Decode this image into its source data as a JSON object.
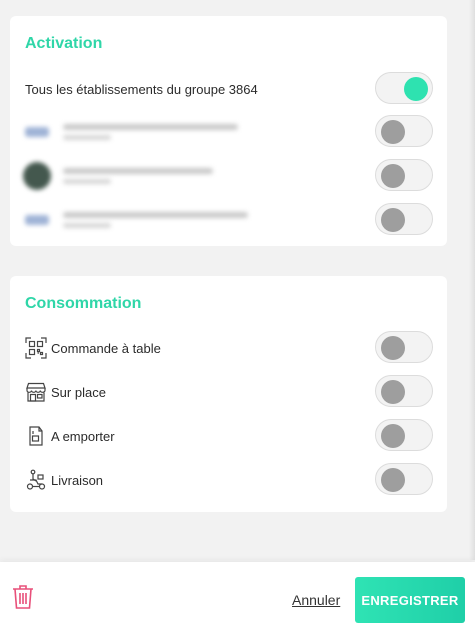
{
  "activation": {
    "title": "Activation",
    "group_label": "Tous les établissements du groupe 3864",
    "group_toggle_on": true,
    "establishments": [
      {
        "icon": "blurred-logo-icon",
        "toggle_on": false
      },
      {
        "icon": "blurred-avatar-icon",
        "toggle_on": false
      },
      {
        "icon": "blurred-logo-icon",
        "toggle_on": false
      }
    ]
  },
  "consommation": {
    "title": "Consommation",
    "items": [
      {
        "label": "Commande à table",
        "icon": "qr-code-icon",
        "toggle_on": false
      },
      {
        "label": "Sur place",
        "icon": "shop-icon",
        "toggle_on": false
      },
      {
        "label": "A emporter",
        "icon": "takeaway-bag-icon",
        "toggle_on": false
      },
      {
        "label": "Livraison",
        "icon": "delivery-scooter-icon",
        "toggle_on": false
      }
    ]
  },
  "footer": {
    "cancel_label": "Annuler",
    "save_label": "ENREGISTRER",
    "delete_icon": "trash-icon"
  },
  "colors": {
    "accent": "#2fd6a8",
    "toggle_on": "#2ee2b0",
    "toggle_off": "#9e9e9e",
    "danger": "#e8507a"
  }
}
